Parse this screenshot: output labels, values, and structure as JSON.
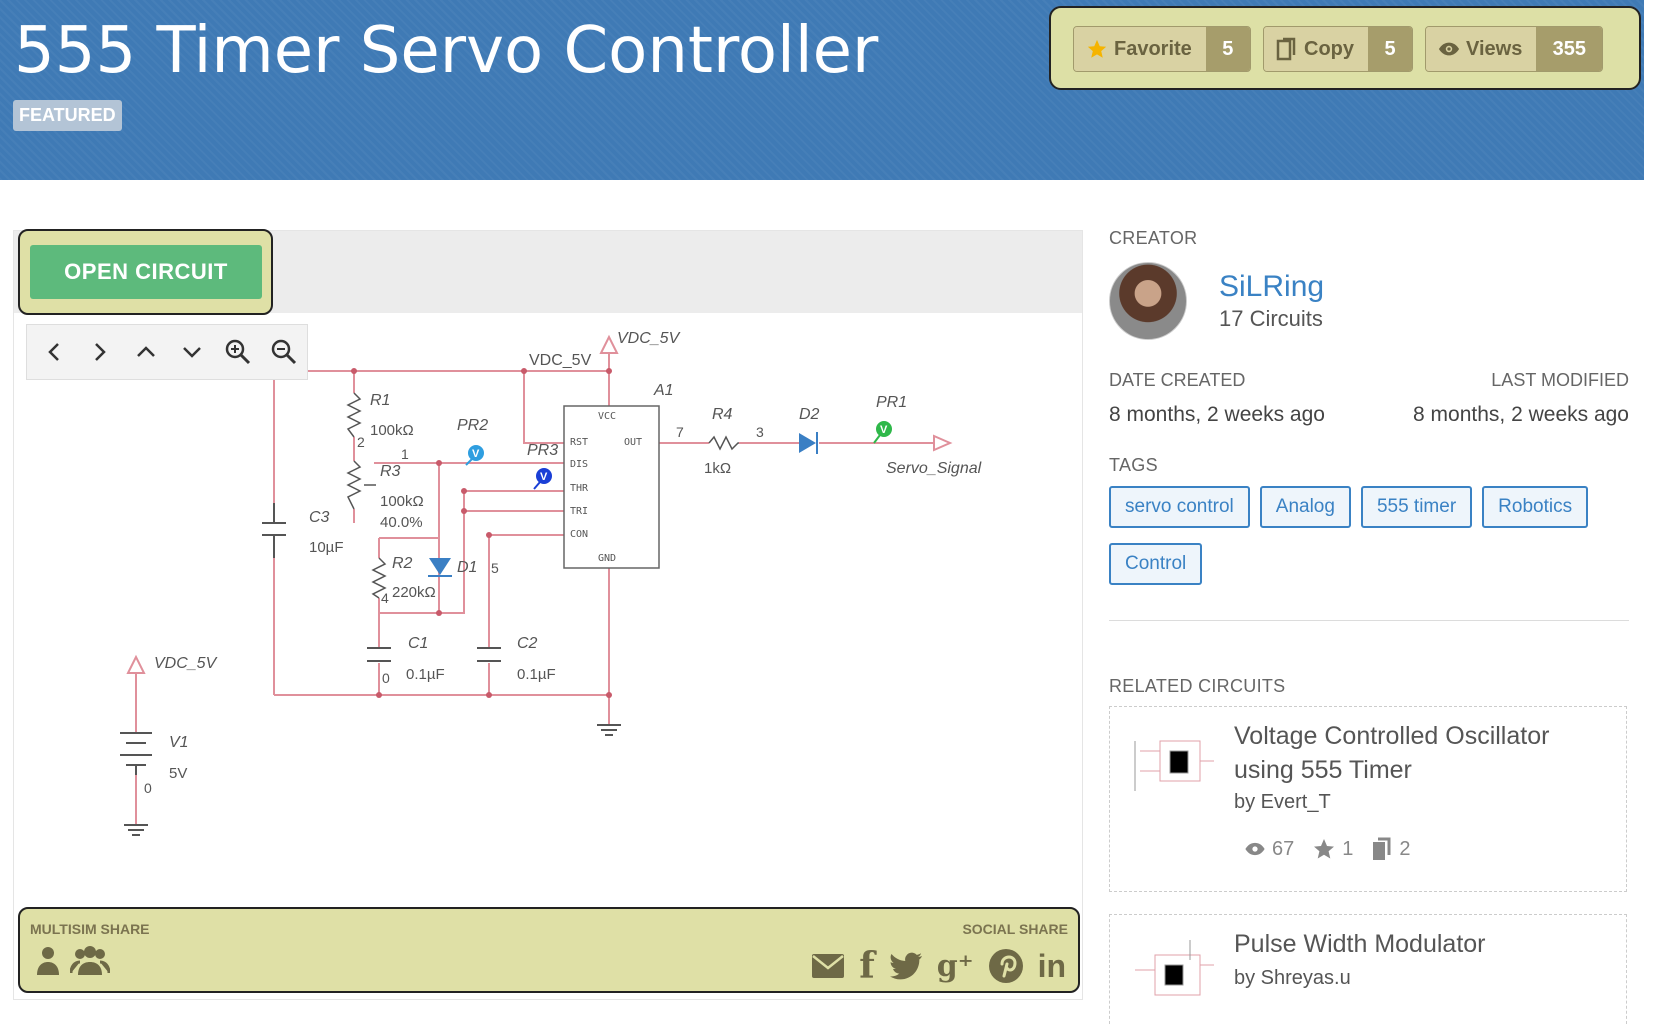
{
  "page": {
    "title": "555 Timer Servo Controller",
    "badge": "FEATURED"
  },
  "stats": {
    "favorite_label": "Favorite",
    "favorite_count": "5",
    "copy_label": "Copy",
    "copy_count": "5",
    "views_label": "Views",
    "views_count": "355"
  },
  "circuit": {
    "open_button": "OPEN CIRCUIT",
    "toolbar_icons": [
      "chevron-left-icon",
      "chevron-right-icon",
      "chevron-up-icon",
      "chevron-down-icon",
      "zoom-in-icon",
      "zoom-out-icon"
    ],
    "labels": {
      "vdc_top": "VDC_5V",
      "vdc_wire": "VDC_5V",
      "a1": "A1",
      "r1": "R1",
      "r1_val": "100kΩ",
      "pr2": "PR2",
      "pr3": "PR3",
      "r3": "R3",
      "r3_val": "100kΩ",
      "r3_pct": "40.0%",
      "c3": "C3",
      "c3_val": "10µF",
      "r2": "R2",
      "r2_val": "220kΩ",
      "d1": "D1",
      "c1": "C1",
      "c1_val": "0.1µF",
      "c2": "C2",
      "c2_val": "0.1µF",
      "r4": "R4",
      "r4_val": "1kΩ",
      "d2": "D2",
      "pr1": "PR1",
      "servo": "Servo_Signal",
      "vdc_left": "VDC_5V",
      "v1": "V1",
      "v1_val": "5V",
      "n2": "2",
      "n1": "1",
      "n4": "4",
      "n5": "5",
      "n7": "7",
      "n3": "3",
      "n0a": "0",
      "n0b": "0",
      "probe_v": "V",
      "pin_vcc": "VCC",
      "pin_rst": "RST",
      "pin_out": "OUT",
      "pin_dis": "DIS",
      "pin_thr": "THR",
      "pin_tri": "TRI",
      "pin_con": "CON",
      "pin_gnd": "GND"
    },
    "colors": {
      "wire": "#e0909b",
      "component": "#555555",
      "probe_blue": "#2f9ee0",
      "probe_dark": "#1a3fd6",
      "probe_green": "#2fb84a",
      "diode": "#3a7fc4"
    }
  },
  "share": {
    "multisim_label": "MULTISIM SHARE",
    "social_label": "SOCIAL SHARE",
    "multisim_icons": [
      "user-icon",
      "group-icon"
    ],
    "social_icons": [
      "email-icon",
      "facebook-icon",
      "twitter-icon",
      "google-plus-icon",
      "pinterest-icon",
      "linkedin-icon"
    ],
    "facebook": "f",
    "google": "g⁺",
    "linkedin": "in"
  },
  "sidebar": {
    "creator_head": "CREATOR",
    "creator_name": "SiLRing",
    "creator_count": "17 Circuits",
    "date_created_label": "DATE CREATED",
    "date_created": "8 months, 2 weeks ago",
    "last_modified_label": "LAST MODIFIED",
    "last_modified": "8 months, 2 weeks ago",
    "tags_head": "TAGS",
    "tags": [
      "servo control",
      "Analog",
      "555 timer",
      "Robotics",
      "Control"
    ],
    "related_head": "RELATED CIRCUITS",
    "related": [
      {
        "title": "Voltage Controlled Oscillator using 555 Timer",
        "by": "by Evert_T",
        "views": "67",
        "favorites": "1",
        "copies": "2"
      },
      {
        "title": "Pulse Width Modulator",
        "by": "by Shreyas.u"
      }
    ]
  }
}
